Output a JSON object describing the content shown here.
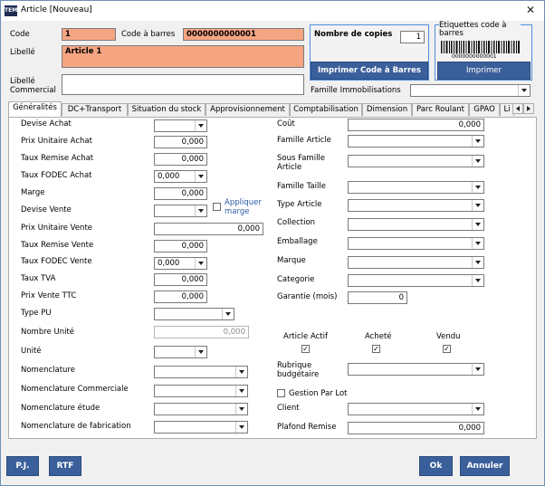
{
  "window": {
    "title": "Article [Nouveau]",
    "icon_text": "TEM",
    "close_glyph": "✕"
  },
  "header": {
    "code_label": "Code",
    "code_value": "1",
    "barcode_label": "Code à barres",
    "barcode_value": "0000000000001",
    "libelle_label": "Libellé",
    "libelle_value": "Article 1",
    "libelle_commercial_label": "Libellé Commercial",
    "libelle_commercial_value": "",
    "famille_immo_label": "Famille Immobilisations",
    "famille_immo_value": ""
  },
  "copies_box": {
    "label": "Nombre de copies",
    "value": "1",
    "print_button": "Imprimer Code à Barres"
  },
  "etiquettes_box": {
    "title": "Etiquettes code à barres",
    "barcode_digits": "0000000000001",
    "print_button": "Imprimer"
  },
  "tabs": [
    {
      "label": "Généralités",
      "active": true
    },
    {
      "label": "DC+Transport"
    },
    {
      "label": "Situation du stock"
    },
    {
      "label": "Approvisionnement"
    },
    {
      "label": "Comptabilisation"
    },
    {
      "label": "Dimension"
    },
    {
      "label": "Parc Roulant"
    },
    {
      "label": "GPAO"
    },
    {
      "label": "Li"
    }
  ],
  "left_fields": {
    "devise_achat": {
      "label": "Devise Achat",
      "value": ""
    },
    "prix_unitaire_achat": {
      "label": "Prix Unitaire Achat",
      "value": "0,000"
    },
    "taux_remise_achat": {
      "label": "Taux Remise Achat",
      "value": "0,000"
    },
    "taux_fodec_achat": {
      "label": "Taux FODEC Achat",
      "value": "0,000"
    },
    "marge": {
      "label": "Marge",
      "value": "0,000"
    },
    "devise_vente": {
      "label": "Devise Vente",
      "value": ""
    },
    "appliquer_marge": {
      "label": "Appliquer marge",
      "checked": false
    },
    "prix_unitaire_vente": {
      "label": "Prix Unitaire Vente",
      "value": "0,000"
    },
    "taux_remise_vente": {
      "label": "Taux Remise Vente",
      "value": "0,000"
    },
    "taux_fodec_vente": {
      "label": "Taux FODEC Vente",
      "value": "0,000"
    },
    "taux_tva": {
      "label": "Taux TVA",
      "value": "0,000"
    },
    "prix_vente_ttc": {
      "label": "Prix Vente TTC",
      "value": "0,000"
    },
    "type_pu": {
      "label": "Type PU",
      "value": ""
    },
    "nombre_unite": {
      "label": "Nombre Unité",
      "value": "0,000"
    },
    "unite": {
      "label": "Unité",
      "value": ""
    },
    "nomenclature": {
      "label": "Nomenclature",
      "value": ""
    },
    "nomenclature_commerciale": {
      "label": "Nomenclature Commerciale",
      "value": ""
    },
    "nomenclature_etude": {
      "label": "Nomenclature étude",
      "value": ""
    },
    "nomenclature_fabrication": {
      "label": "Nomenclature de fabrication",
      "value": ""
    }
  },
  "right_fields": {
    "cout": {
      "label": "Coût",
      "value": "0,000"
    },
    "famille_article": {
      "label": "Famille Article",
      "value": ""
    },
    "sous_famille_article": {
      "label": "Sous Famille Article",
      "value": ""
    },
    "famille_taille": {
      "label": "Famille Taille",
      "value": ""
    },
    "type_article": {
      "label": "Type Article",
      "value": ""
    },
    "collection": {
      "label": "Collection",
      "value": ""
    },
    "emballage": {
      "label": "Emballage",
      "value": ""
    },
    "marque": {
      "label": "Marque",
      "value": ""
    },
    "categorie": {
      "label": "Categorie",
      "value": ""
    },
    "garantie": {
      "label": "Garantie (mois)",
      "value": "0"
    },
    "article_actif": {
      "label": "Article Actif",
      "checked": true
    },
    "achete": {
      "label": "Acheté",
      "checked": true
    },
    "vendu": {
      "label": "Vendu",
      "checked": true
    },
    "rubrique_budgetaire": {
      "label": "Rubrique budgétaire",
      "value": ""
    },
    "gestion_par_lot": {
      "label": "Gestion Par Lot",
      "checked": false
    },
    "client": {
      "label": "Client",
      "value": ""
    },
    "plafond_remise": {
      "label": "Plafond Remise",
      "value": "0,000"
    }
  },
  "footer": {
    "pj_button": "P.J.",
    "rtf_button": "RTF",
    "ok_button": "Ok",
    "cancel_button": "Annuler"
  },
  "colors": {
    "accent_blue": "#3a5f9a",
    "orange_field": "#f6a582",
    "group_border": "#4f8edc"
  }
}
